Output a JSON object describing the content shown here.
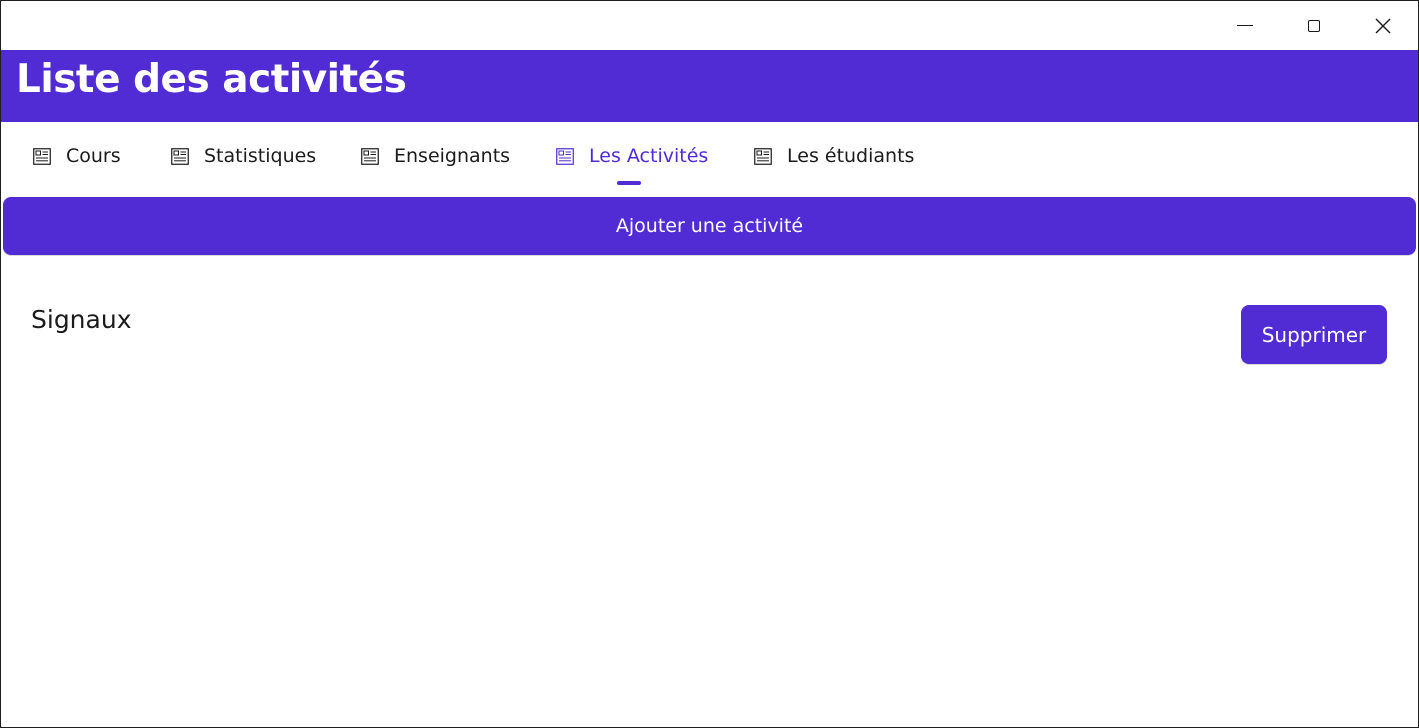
{
  "colors": {
    "accent": "#512bd4",
    "text": "#1b1b1b",
    "background": "#ffffff"
  },
  "window": {
    "controls": [
      "minimize-icon",
      "maximize-icon",
      "close-icon"
    ]
  },
  "header": {
    "title": "Liste des activités"
  },
  "tabs": [
    {
      "label": "Cours",
      "icon": "list-doc-icon",
      "active": false
    },
    {
      "label": "Statistiques",
      "icon": "list-doc-icon",
      "active": false
    },
    {
      "label": "Enseignants",
      "icon": "list-doc-icon",
      "active": false
    },
    {
      "label": "Les Activités",
      "icon": "list-doc-icon",
      "active": true
    },
    {
      "label": "Les étudiants",
      "icon": "list-doc-icon",
      "active": false
    }
  ],
  "main": {
    "add_label": "Ajouter une activité",
    "items": [
      {
        "name": "Signaux",
        "delete_label": "Supprimer"
      }
    ]
  }
}
